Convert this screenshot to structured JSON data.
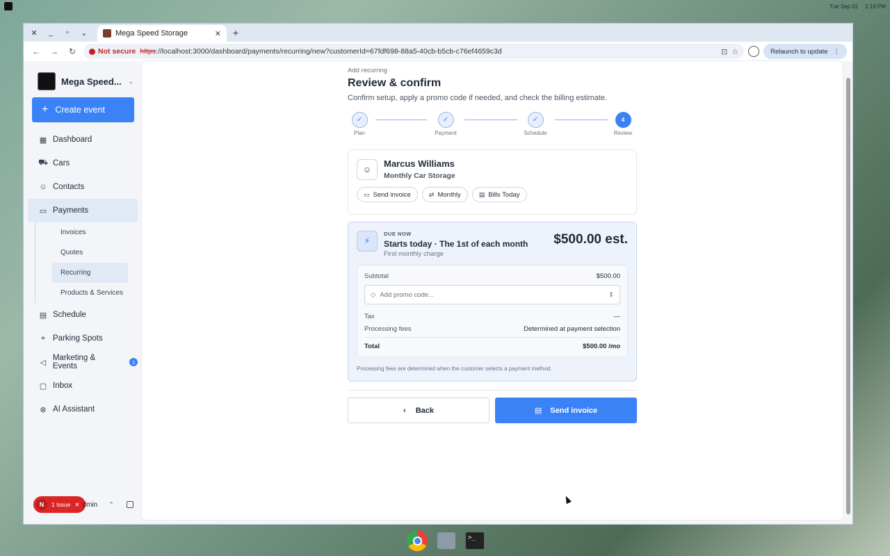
{
  "os": {
    "date": "Tue Sep 01",
    "time": "1:19 PM"
  },
  "browser": {
    "tab_title": "Mega Speed Storage",
    "not_secure": "Not secure",
    "url_scheme": "https",
    "url_rest": "://localhost:3000/dashboard/payments/recurring/new?customerId=67fdf698-88a5-40cb-b5cb-c76ef4659c3d",
    "relaunch_label": "Relaunch to update"
  },
  "sidebar": {
    "brand": "Mega Speed...",
    "create_label": "Create event",
    "items": [
      {
        "label": "Dashboard",
        "icon": "dashboard-icon"
      },
      {
        "label": "Cars",
        "icon": "car-icon"
      },
      {
        "label": "Contacts",
        "icon": "contacts-icon"
      },
      {
        "label": "Payments",
        "icon": "card-icon"
      }
    ],
    "sub_items": [
      "Invoices",
      "Quotes",
      "Recurring",
      "Products & Services"
    ],
    "items_after": [
      {
        "label": "Schedule",
        "icon": "calendar-icon"
      },
      {
        "label": "Parking Spots",
        "icon": "pin-icon"
      },
      {
        "label": "Marketing & Events",
        "icon": "megaphone-icon",
        "badge": "1"
      },
      {
        "label": "Inbox",
        "icon": "inbox-icon"
      },
      {
        "label": "AI Assistant",
        "icon": "ai-icon"
      }
    ],
    "issue_count": "N",
    "issue_label": "1 Issue",
    "footer_user": "dmin"
  },
  "main": {
    "eyebrow": "Add recurring",
    "title": "Review & confirm",
    "subtitle": "Confirm setup, apply a promo code if needed, and check the billing estimate.",
    "steps": [
      {
        "label": "Plan",
        "state": "done"
      },
      {
        "label": "Payment",
        "state": "done"
      },
      {
        "label": "Schedule",
        "state": "done"
      },
      {
        "label": "Review",
        "state": "current",
        "number": "4"
      }
    ],
    "customer": {
      "name": "Marcus Williams",
      "plan": "Monthly Car Storage",
      "chips": [
        "Send invoice",
        "Monthly",
        "Bills Today"
      ]
    },
    "due": {
      "label": "DUE NOW",
      "title": "Starts today · The 1st of each month",
      "desc": "First monthly charge",
      "amount": "$500.00 est.",
      "subtotal_label": "Subtotal",
      "subtotal_value": "$500.00",
      "promo_placeholder": "Add promo code...",
      "tax_label": "Tax",
      "tax_value": "—",
      "fees_label": "Processing fees",
      "fees_value": "Determined at payment selection",
      "total_label": "Total",
      "total_value": "$500.00 /mo",
      "footnote": "Processing fees are determined when the customer selects a payment method."
    },
    "back_label": "Back",
    "send_label": "Send invoice"
  }
}
